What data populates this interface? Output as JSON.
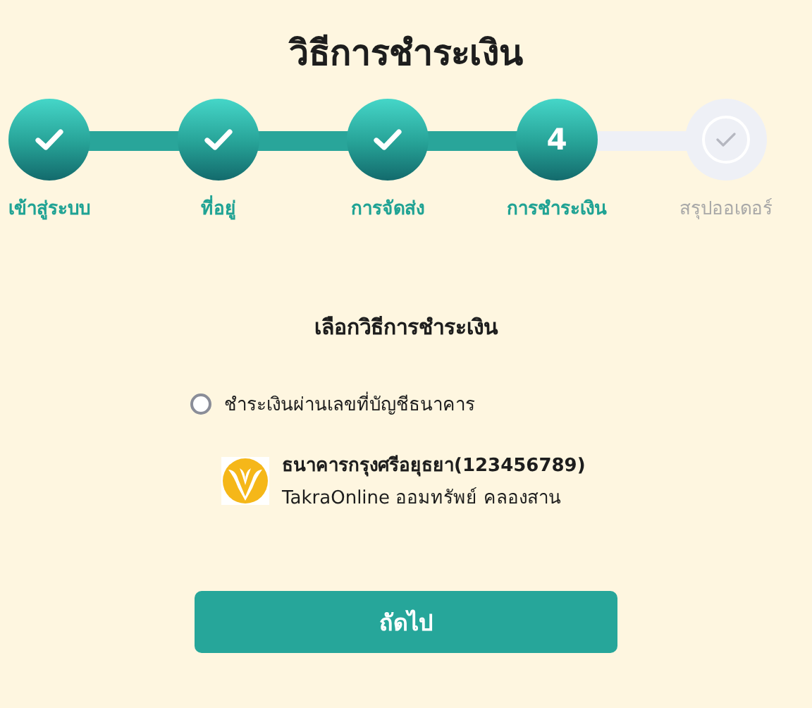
{
  "title": "วิธีการชำระเงิน",
  "steps": [
    {
      "label": "เข้าสู่ระบบ",
      "kind": "done"
    },
    {
      "label": "ที่อยู่",
      "kind": "done"
    },
    {
      "label": "การจัดส่ง",
      "kind": "done"
    },
    {
      "label": "การชำระเงิน",
      "kind": "current",
      "number": "4"
    },
    {
      "label": "สรุปออเดอร์",
      "kind": "upcoming"
    }
  ],
  "section_title": "เลือกวิธีการชำระเงิน",
  "payment_option": {
    "label": "ชำระเงินผ่านเลขที่บัญชีธนาคาร",
    "selected": false
  },
  "bank": {
    "name": "ธนาคารกรุงศรีอยุธยา(123456789)",
    "account": "TakraOnline ออมทรัพย์ คลองสาน"
  },
  "next_button": "ถัดไป"
}
